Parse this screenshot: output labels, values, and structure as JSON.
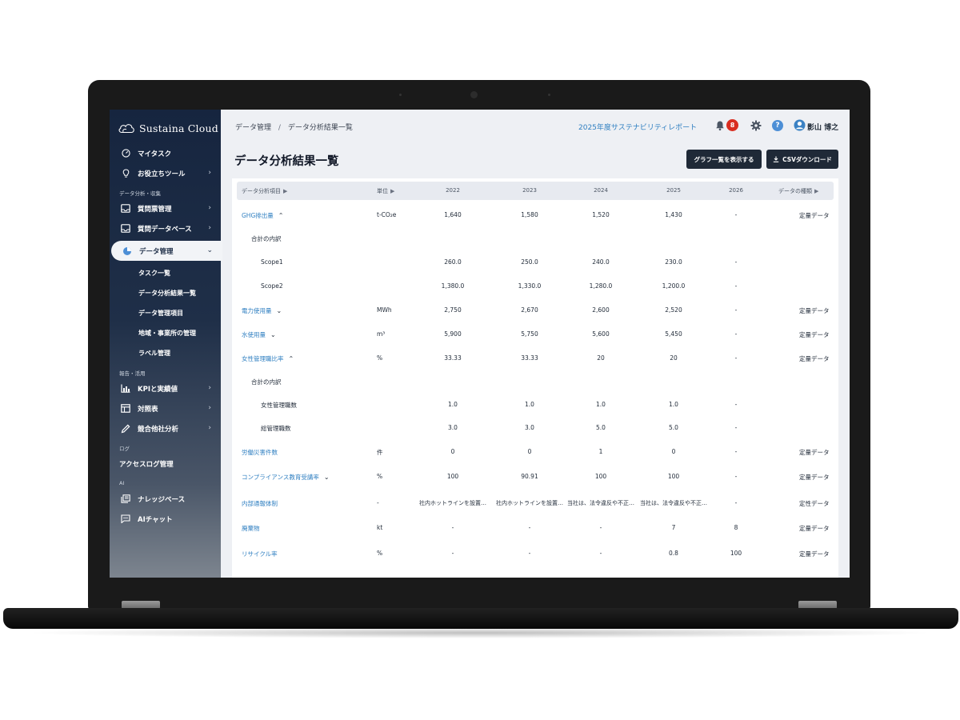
{
  "brand": {
    "name": "Sustaina Cloud"
  },
  "sidebar": {
    "items": [
      {
        "label": "マイタスク",
        "icon": "dashboard-icon"
      },
      {
        "label": "お役立ちツール",
        "icon": "lightbulb-icon",
        "chevron": "›"
      }
    ],
    "section_collect": "データ分析・収集",
    "collect_items": [
      {
        "label": "質問票管理",
        "icon": "inbox-icon",
        "chevron": "›"
      },
      {
        "label": "質問データベース",
        "icon": "inbox-icon",
        "chevron": "›"
      }
    ],
    "active_item": {
      "label": "データ管理",
      "icon": "pie-chart-icon",
      "chevron": "⌄"
    },
    "sub_items": [
      "タスク一覧",
      "データ分析結果一覧",
      "データ管理項目",
      "地域・事業所の管理",
      "ラベル管理"
    ],
    "section_report": "報告・活用",
    "report_items": [
      {
        "label": "KPIと実績値",
        "icon": "bar-chart-icon",
        "chevron": "›"
      },
      {
        "label": "対照表",
        "icon": "table-icon",
        "chevron": "›"
      },
      {
        "label": "競合他社分析",
        "icon": "pencil-icon",
        "chevron": "›"
      }
    ],
    "section_log": "ログ",
    "log_item": "アクセスログ管理",
    "section_ai": "AI",
    "ai_items": [
      {
        "label": "ナレッジベース",
        "icon": "library-icon"
      },
      {
        "label": "AIチャット",
        "icon": "chat-icon"
      }
    ]
  },
  "header": {
    "breadcrumb": [
      "データ管理",
      "データ分析結果一覧"
    ],
    "breadcrumb_sep": "/",
    "report_link": "2025年度サステナビリティレポート",
    "notification_count": "8",
    "help": "?",
    "user_name": "影山 博之"
  },
  "page": {
    "title": "データ分析結果一覧",
    "btn_graph": "グラフ一覧を表示する",
    "btn_csv": "CSVダウンロード"
  },
  "table": {
    "headers": {
      "item": "データ分析項目",
      "unit": "単位",
      "y2022": "2022",
      "y2023": "2023",
      "y2024": "2024",
      "y2025": "2025",
      "y2026": "2026",
      "type": "データの種類",
      "sort_marker": "▶"
    },
    "rows": [
      {
        "name": "GHG排出量",
        "level": 0,
        "link": true,
        "expander": "⌃",
        "unit": "t-CO₂e",
        "v": [
          "1,640",
          "1,580",
          "1,520",
          "1,430",
          "-"
        ],
        "type": "定量データ"
      },
      {
        "name": "合計の内訳",
        "level": 1,
        "link": false,
        "expander": "",
        "unit": "",
        "v": [
          "",
          "",
          "",
          "",
          ""
        ],
        "type": ""
      },
      {
        "name": "Scope1",
        "level": 2,
        "link": false,
        "expander": "",
        "unit": "",
        "v": [
          "260.0",
          "250.0",
          "240.0",
          "230.0",
          "-"
        ],
        "type": ""
      },
      {
        "name": "Scope2",
        "level": 2,
        "link": false,
        "expander": "",
        "unit": "",
        "v": [
          "1,380.0",
          "1,330.0",
          "1,280.0",
          "1,200.0",
          "-"
        ],
        "type": ""
      },
      {
        "name": "電力使用量",
        "level": 0,
        "link": true,
        "expander": "⌄",
        "unit": "MWh",
        "v": [
          "2,750",
          "2,670",
          "2,600",
          "2,520",
          "-"
        ],
        "type": "定量データ"
      },
      {
        "name": "水使用量",
        "level": 0,
        "link": true,
        "expander": "⌄",
        "unit": "m³",
        "v": [
          "5,900",
          "5,750",
          "5,600",
          "5,450",
          "-"
        ],
        "type": "定量データ"
      },
      {
        "name": "女性管理職比率",
        "level": 0,
        "link": true,
        "expander": "⌃",
        "unit": "%",
        "v": [
          "33.33",
          "33.33",
          "20",
          "20",
          "-"
        ],
        "type": "定量データ"
      },
      {
        "name": "合計の内訳",
        "level": 1,
        "link": false,
        "expander": "",
        "unit": "",
        "v": [
          "",
          "",
          "",
          "",
          ""
        ],
        "type": ""
      },
      {
        "name": "女性管理職数",
        "level": 2,
        "link": false,
        "expander": "",
        "unit": "",
        "v": [
          "1.0",
          "1.0",
          "1.0",
          "1.0",
          "-"
        ],
        "type": ""
      },
      {
        "name": "総管理職数",
        "level": 2,
        "link": false,
        "expander": "",
        "unit": "",
        "v": [
          "3.0",
          "3.0",
          "5.0",
          "5.0",
          "-"
        ],
        "type": ""
      },
      {
        "name": "労働災害件数",
        "level": 0,
        "link": true,
        "expander": "",
        "unit": "件",
        "v": [
          "0",
          "0",
          "1",
          "0",
          "-"
        ],
        "type": "定量データ"
      },
      {
        "name": "コンプライアンス教育受講率",
        "level": 0,
        "link": true,
        "expander": "⌄",
        "unit": "%",
        "v": [
          "100",
          "90.91",
          "100",
          "100",
          "-"
        ],
        "type": "定量データ"
      },
      {
        "name": "内部通報体制",
        "level": 0,
        "link": true,
        "expander": "",
        "unit": "-",
        "v": [
          "社内ホットラインを設置…",
          "社内ホットラインを設置…",
          "当社は、法令違反や不正…",
          "当社は、法令違反や不正…",
          "-"
        ],
        "type": "定性データ"
      },
      {
        "name": "廃棄物",
        "level": 0,
        "link": true,
        "expander": "",
        "unit": "kt",
        "v": [
          "-",
          "-",
          "-",
          "7",
          "8"
        ],
        "type": "定量データ"
      },
      {
        "name": "リサイクル率",
        "level": 0,
        "link": true,
        "expander": "",
        "unit": "%",
        "v": [
          "-",
          "-",
          "-",
          "0.8",
          "100"
        ],
        "type": "定量データ"
      }
    ]
  }
}
